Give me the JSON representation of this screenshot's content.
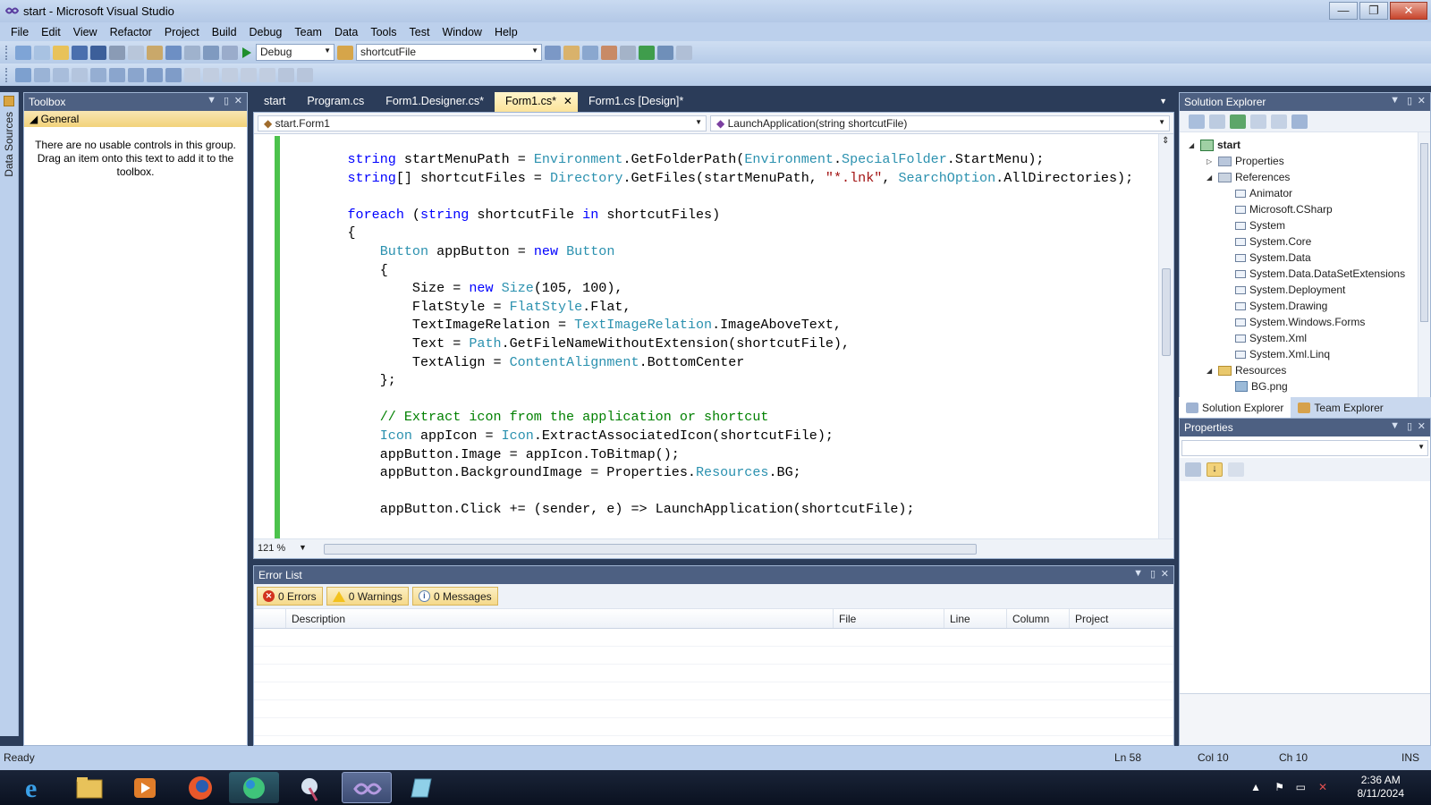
{
  "window": {
    "title": "start - Microsoft Visual Studio",
    "minimize": "—",
    "restore": "❐",
    "close": "✕"
  },
  "menu": [
    "File",
    "Edit",
    "View",
    "Refactor",
    "Project",
    "Build",
    "Debug",
    "Team",
    "Data",
    "Tools",
    "Test",
    "Window",
    "Help"
  ],
  "toolbar": {
    "config": "Debug",
    "find_combo": "shortcutFile"
  },
  "side_strip": {
    "label": "Data Sources"
  },
  "toolbox": {
    "title": "Toolbox",
    "group": "General",
    "empty_text": "There are no usable controls in this group. Drag an item onto this text to add it to the toolbox."
  },
  "tabs": [
    {
      "label": "start"
    },
    {
      "label": "Program.cs"
    },
    {
      "label": "Form1.Designer.cs*"
    },
    {
      "label": "Form1.cs*",
      "active": true,
      "close": "✕"
    },
    {
      "label": "Form1.cs [Design]*"
    }
  ],
  "editor": {
    "class_combo": "start.Form1",
    "member_combo": "LaunchApplication(string shortcutFile)",
    "zoom": "121 %",
    "code": [
      "        string startMenuPath = Environment.GetFolderPath(Environment.SpecialFolder.StartMenu);",
      "        string[] shortcutFiles = Directory.GetFiles(startMenuPath, \"*.lnk\", SearchOption.AllDirectories);",
      "",
      "        foreach (string shortcutFile in shortcutFiles)",
      "        {",
      "            Button appButton = new Button",
      "            {",
      "                Size = new Size(105, 100),",
      "                FlatStyle = FlatStyle.Flat,",
      "                TextImageRelation = TextImageRelation.ImageAboveText,",
      "                Text = Path.GetFileNameWithoutExtension(shortcutFile),",
      "                TextAlign = ContentAlignment.BottomCenter",
      "            };",
      "",
      "            // Extract icon from the application or shortcut",
      "            Icon appIcon = Icon.ExtractAssociatedIcon(shortcutFile);",
      "            appButton.Image = appIcon.ToBitmap();",
      "            appButton.BackgroundImage = Properties.Resources.BG;",
      "",
      "            appButton.Click += (sender, e) => LaunchApplication(shortcutFile);"
    ]
  },
  "error_list": {
    "title": "Error List",
    "errors": "0 Errors",
    "warnings": "0 Warnings",
    "messages": "0 Messages",
    "columns": [
      "Description",
      "File",
      "Line",
      "Column",
      "Project"
    ]
  },
  "solution_explorer": {
    "title": "Solution Explorer",
    "project": "start",
    "properties_node": "Properties",
    "references_node": "References",
    "references": [
      "Animator",
      "Microsoft.CSharp",
      "System",
      "System.Core",
      "System.Data",
      "System.Data.DataSetExtensions",
      "System.Deployment",
      "System.Drawing",
      "System.Windows.Forms",
      "System.Xml",
      "System.Xml.Linq"
    ],
    "resources_node": "Resources",
    "resource_files": [
      "BG.png"
    ],
    "tab_solution": "Solution Explorer",
    "tab_team": "Team Explorer"
  },
  "properties_panel": {
    "title": "Properties"
  },
  "status": {
    "text": "Ready",
    "ln": "Ln 58",
    "col": "Col 10",
    "ch": "Ch 10",
    "mode": "INS"
  },
  "taskbar": {
    "time": "2:36 AM",
    "date": "8/11/2024"
  },
  "colors": {
    "accent_green": "#4cc24c",
    "keyword": "#0000ff",
    "type": "#2b91af",
    "string": "#a31515",
    "comment": "#008000"
  }
}
